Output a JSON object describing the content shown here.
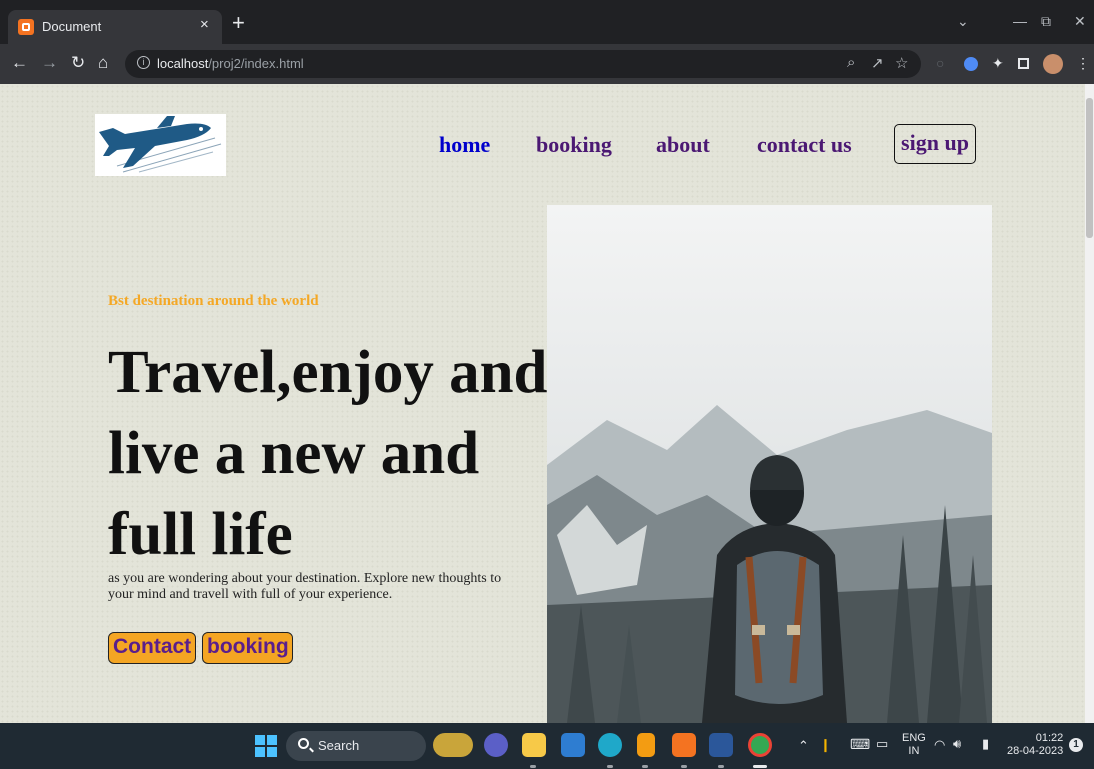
{
  "browser": {
    "tab_title": "Document",
    "tab_close": "×",
    "new_tab": "+",
    "url_host": "localhost",
    "url_path": "/proj2/index.html"
  },
  "site": {
    "nav": [
      "home",
      "booking",
      "about",
      "contact us"
    ],
    "signup_label": "sign up",
    "tagline": "Bst destination around the world",
    "headline": "Travel,enjoy and live a new and full life",
    "description": "as you are wondering about your destination. Explore new thoughts to your mind and travell with full of your experience.",
    "buttons": {
      "contact": "Contact",
      "booking": "booking"
    },
    "colors": {
      "nav_active": "#0000cc",
      "nav": "#4b1873",
      "tagline": "#f4a826",
      "button_bg": "#f4a523",
      "button_text": "#5a1e8c"
    }
  },
  "taskbar": {
    "search_label": "Search",
    "lang_top": "ENG",
    "lang_bottom": "IN",
    "time": "01:22",
    "date": "28-04-2023",
    "notification_count": "1"
  }
}
